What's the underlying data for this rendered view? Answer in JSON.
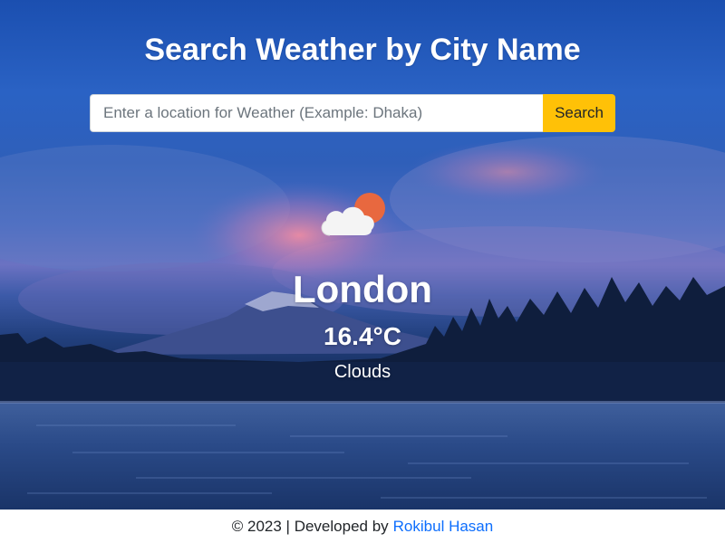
{
  "header": {
    "title": "Search Weather by City Name"
  },
  "search": {
    "placeholder": "Enter a location for Weather (Example: Dhaka)",
    "value": "",
    "button_label": "Search"
  },
  "weather": {
    "icon": "cloud-with-sun-icon",
    "city": "London",
    "temperature": "16.4°C",
    "condition": "Clouds"
  },
  "footer": {
    "text": "© 2023 | Developed by",
    "author_link": "Rokibul Hasan",
    "link_color": "#0d6efd"
  },
  "colors": {
    "search_button": "#ffc107",
    "text_light": "#ffffff",
    "sun": "#e8683f"
  }
}
